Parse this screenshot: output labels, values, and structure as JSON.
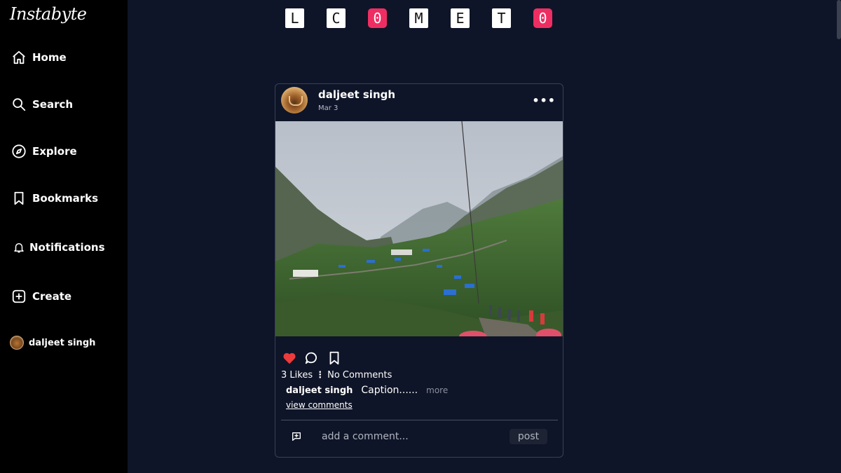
{
  "app": {
    "logo": "Instabyte"
  },
  "sidebar": {
    "items": [
      {
        "label": "Home",
        "icon": "home-icon"
      },
      {
        "label": "Search",
        "icon": "search-icon"
      },
      {
        "label": "Explore",
        "icon": "compass-icon"
      },
      {
        "label": "Bookmarks",
        "icon": "bookmark-icon"
      },
      {
        "label": "Notifications",
        "icon": "bell-icon"
      },
      {
        "label": "Create",
        "icon": "plus-square-icon"
      },
      {
        "label": "daljeet singh",
        "icon": "avatar"
      }
    ]
  },
  "tiles": [
    "L",
    "C",
    "0",
    "M",
    "E",
    "T",
    "0"
  ],
  "colors": {
    "accent": "#ee2e62",
    "background": "#0f1528",
    "sidebar": "#000000",
    "like": "#ed3b3b"
  },
  "post": {
    "username": "daljeet singh",
    "date": "Mar 3",
    "more": "•••",
    "likes": "3 Likes",
    "separator": "⋮",
    "comments_count": "No Comments",
    "caption_user": "daljeet singh",
    "caption": "Caption......",
    "more_link": "more",
    "view_comments": "view comments",
    "liked": true,
    "comment_placeholder": "add a comment...",
    "post_button": "post"
  }
}
